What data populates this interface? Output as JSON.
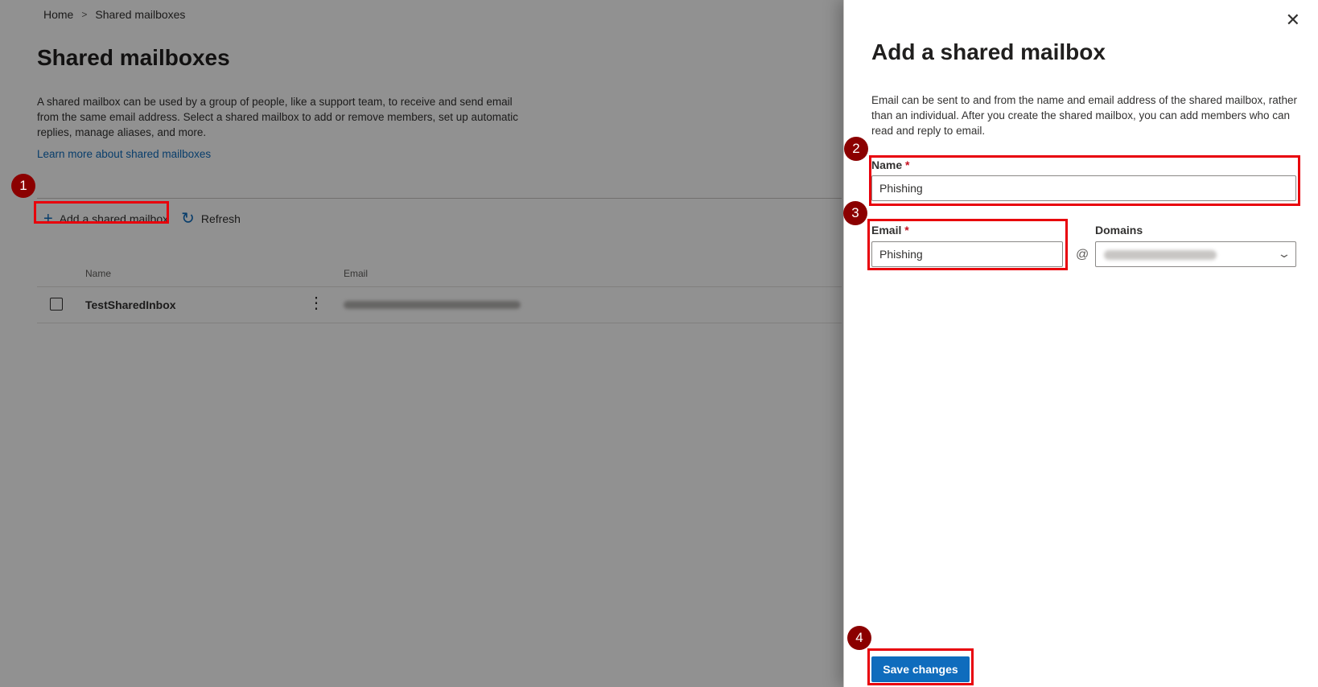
{
  "breadcrumb": {
    "home": "Home",
    "separator": ">",
    "current": "Shared mailboxes"
  },
  "page": {
    "title": "Shared mailboxes",
    "description": "A shared mailbox can be used by a group of people, like a support team, to receive and send email from the same email address. Select a shared mailbox to add or remove members, set up automatic replies, manage aliases, and more.",
    "learn_more": "Learn more about shared mailboxes"
  },
  "toolbar": {
    "add_label": "Add a shared mailbox",
    "add_icon": "+",
    "refresh_label": "Refresh",
    "refresh_icon": "↻"
  },
  "table": {
    "columns": [
      "Name",
      "Email"
    ],
    "rows": [
      {
        "name": "TestSharedInbox",
        "more_icon": "⋮"
      }
    ]
  },
  "panel": {
    "close_icon": "✕",
    "title": "Add a shared mailbox",
    "description": "Email can be sent to and from the name and email address of the shared mailbox, rather than an individual. After you create the shared mailbox, you can add members who can read and reply to email.",
    "name_label": "Name",
    "name_value": "Phishing",
    "email_label": "Email",
    "email_value": "Phishing",
    "required_marker": "*",
    "at_sign": "@",
    "domains_label": "Domains",
    "chevron_icon": "⌄",
    "save_label": "Save changes"
  },
  "annotations": [
    "1",
    "2",
    "3",
    "4"
  ],
  "colors": {
    "accent": "#0f6cbd",
    "highlight": "#e8000b",
    "badge": "#8b0000",
    "overlay": "rgba(0,0,0,0.43)"
  }
}
